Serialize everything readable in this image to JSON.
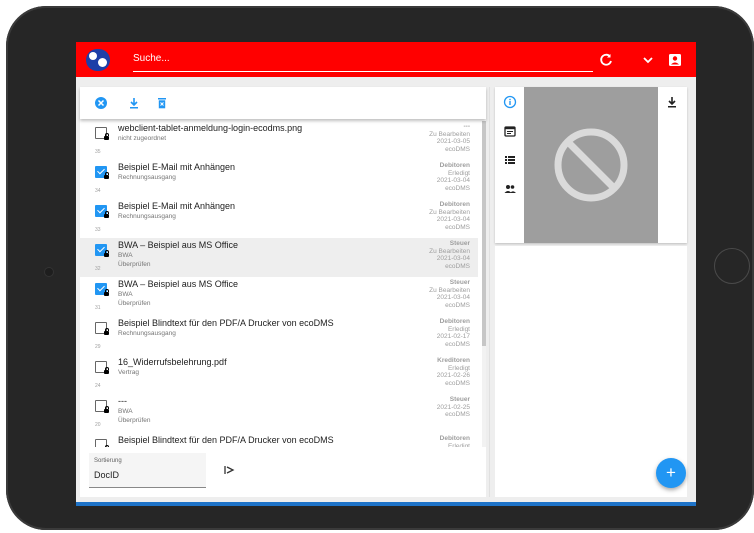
{
  "app": {
    "search_placeholder": "Suche...",
    "colors": {
      "header": "#ff0000",
      "accent": "#2196f3",
      "preview_bg": "#9e9e9e"
    },
    "icons": [
      "refresh-icon",
      "chevron-down-icon",
      "account-box-icon"
    ]
  },
  "toolbar": {
    "icons": [
      "cancel-icon",
      "download-icon",
      "delete-icon"
    ]
  },
  "documents": [
    {
      "title": "webclient-tablet-anmeldung-login-ecodms.png",
      "sub1": "nicht zugeordnet",
      "sub2": "",
      "docid": "35",
      "checked": false,
      "category": "---",
      "status": "Zu Bearbeiten",
      "date": "2021-03-05",
      "owner": "ecoDMS"
    },
    {
      "title": "Beispiel E-Mail mit Anhängen",
      "sub1": "Rechnungsausgang",
      "sub2": "",
      "docid": "34",
      "checked": true,
      "category": "Debitoren",
      "status": "Erledigt",
      "date": "2021-03-04",
      "owner": "ecoDMS"
    },
    {
      "title": "Beispiel E-Mail mit Anhängen",
      "sub1": "Rechnungsausgang",
      "sub2": "",
      "docid": "33",
      "checked": true,
      "category": "Debitoren",
      "status": "Zu Bearbeiten",
      "date": "2021-03-04",
      "owner": "ecoDMS"
    },
    {
      "title": "BWA – Beispiel aus MS Office",
      "sub1": "BWA",
      "sub2": "Überprüfen",
      "docid": "32",
      "checked": true,
      "category": "Steuer",
      "status": "Zu Bearbeiten",
      "date": "2021-03-04",
      "owner": "ecoDMS",
      "selected": true
    },
    {
      "title": "BWA – Beispiel aus MS Office",
      "sub1": "BWA",
      "sub2": "Überprüfen",
      "docid": "31",
      "checked": true,
      "category": "Steuer",
      "status": "Zu Bearbeiten",
      "date": "2021-03-04",
      "owner": "ecoDMS"
    },
    {
      "title": "Beispiel Blindtext für den PDF/A Drucker von ecoDMS",
      "sub1": "Rechnungsausgang",
      "sub2": "",
      "docid": "29",
      "checked": false,
      "category": "Debitoren",
      "status": "Erledigt",
      "date": "2021-02-17",
      "owner": "ecoDMS"
    },
    {
      "title": "16_Widerrufsbelehrung.pdf",
      "sub1": "Vertrag",
      "sub2": "",
      "docid": "24",
      "checked": false,
      "category": "Kreditoren",
      "status": "Erledigt",
      "date": "2021-02-26",
      "owner": "ecoDMS"
    },
    {
      "title": "---",
      "sub1": "BWA",
      "sub2": "Überprüfen",
      "docid": "20",
      "checked": false,
      "category": "Steuer",
      "status": "",
      "date": "2021-02-25",
      "owner": "ecoDMS"
    },
    {
      "title": "Beispiel Blindtext für den PDF/A Drucker von ecoDMS",
      "sub1": "Rechnungsausgang",
      "sub2": "",
      "docid": "",
      "checked": false,
      "category": "Debitoren",
      "status": "Erledigt",
      "date": "",
      "owner": ""
    }
  ],
  "sorting": {
    "label": "Sortierung",
    "value": "DocID"
  },
  "right_panel": {
    "icons": [
      "info-icon",
      "calendar-icon",
      "list-icon",
      "people-icon",
      "download-icon"
    ],
    "preview_icon": "no-preview-icon"
  },
  "fab": {
    "label": "+"
  }
}
